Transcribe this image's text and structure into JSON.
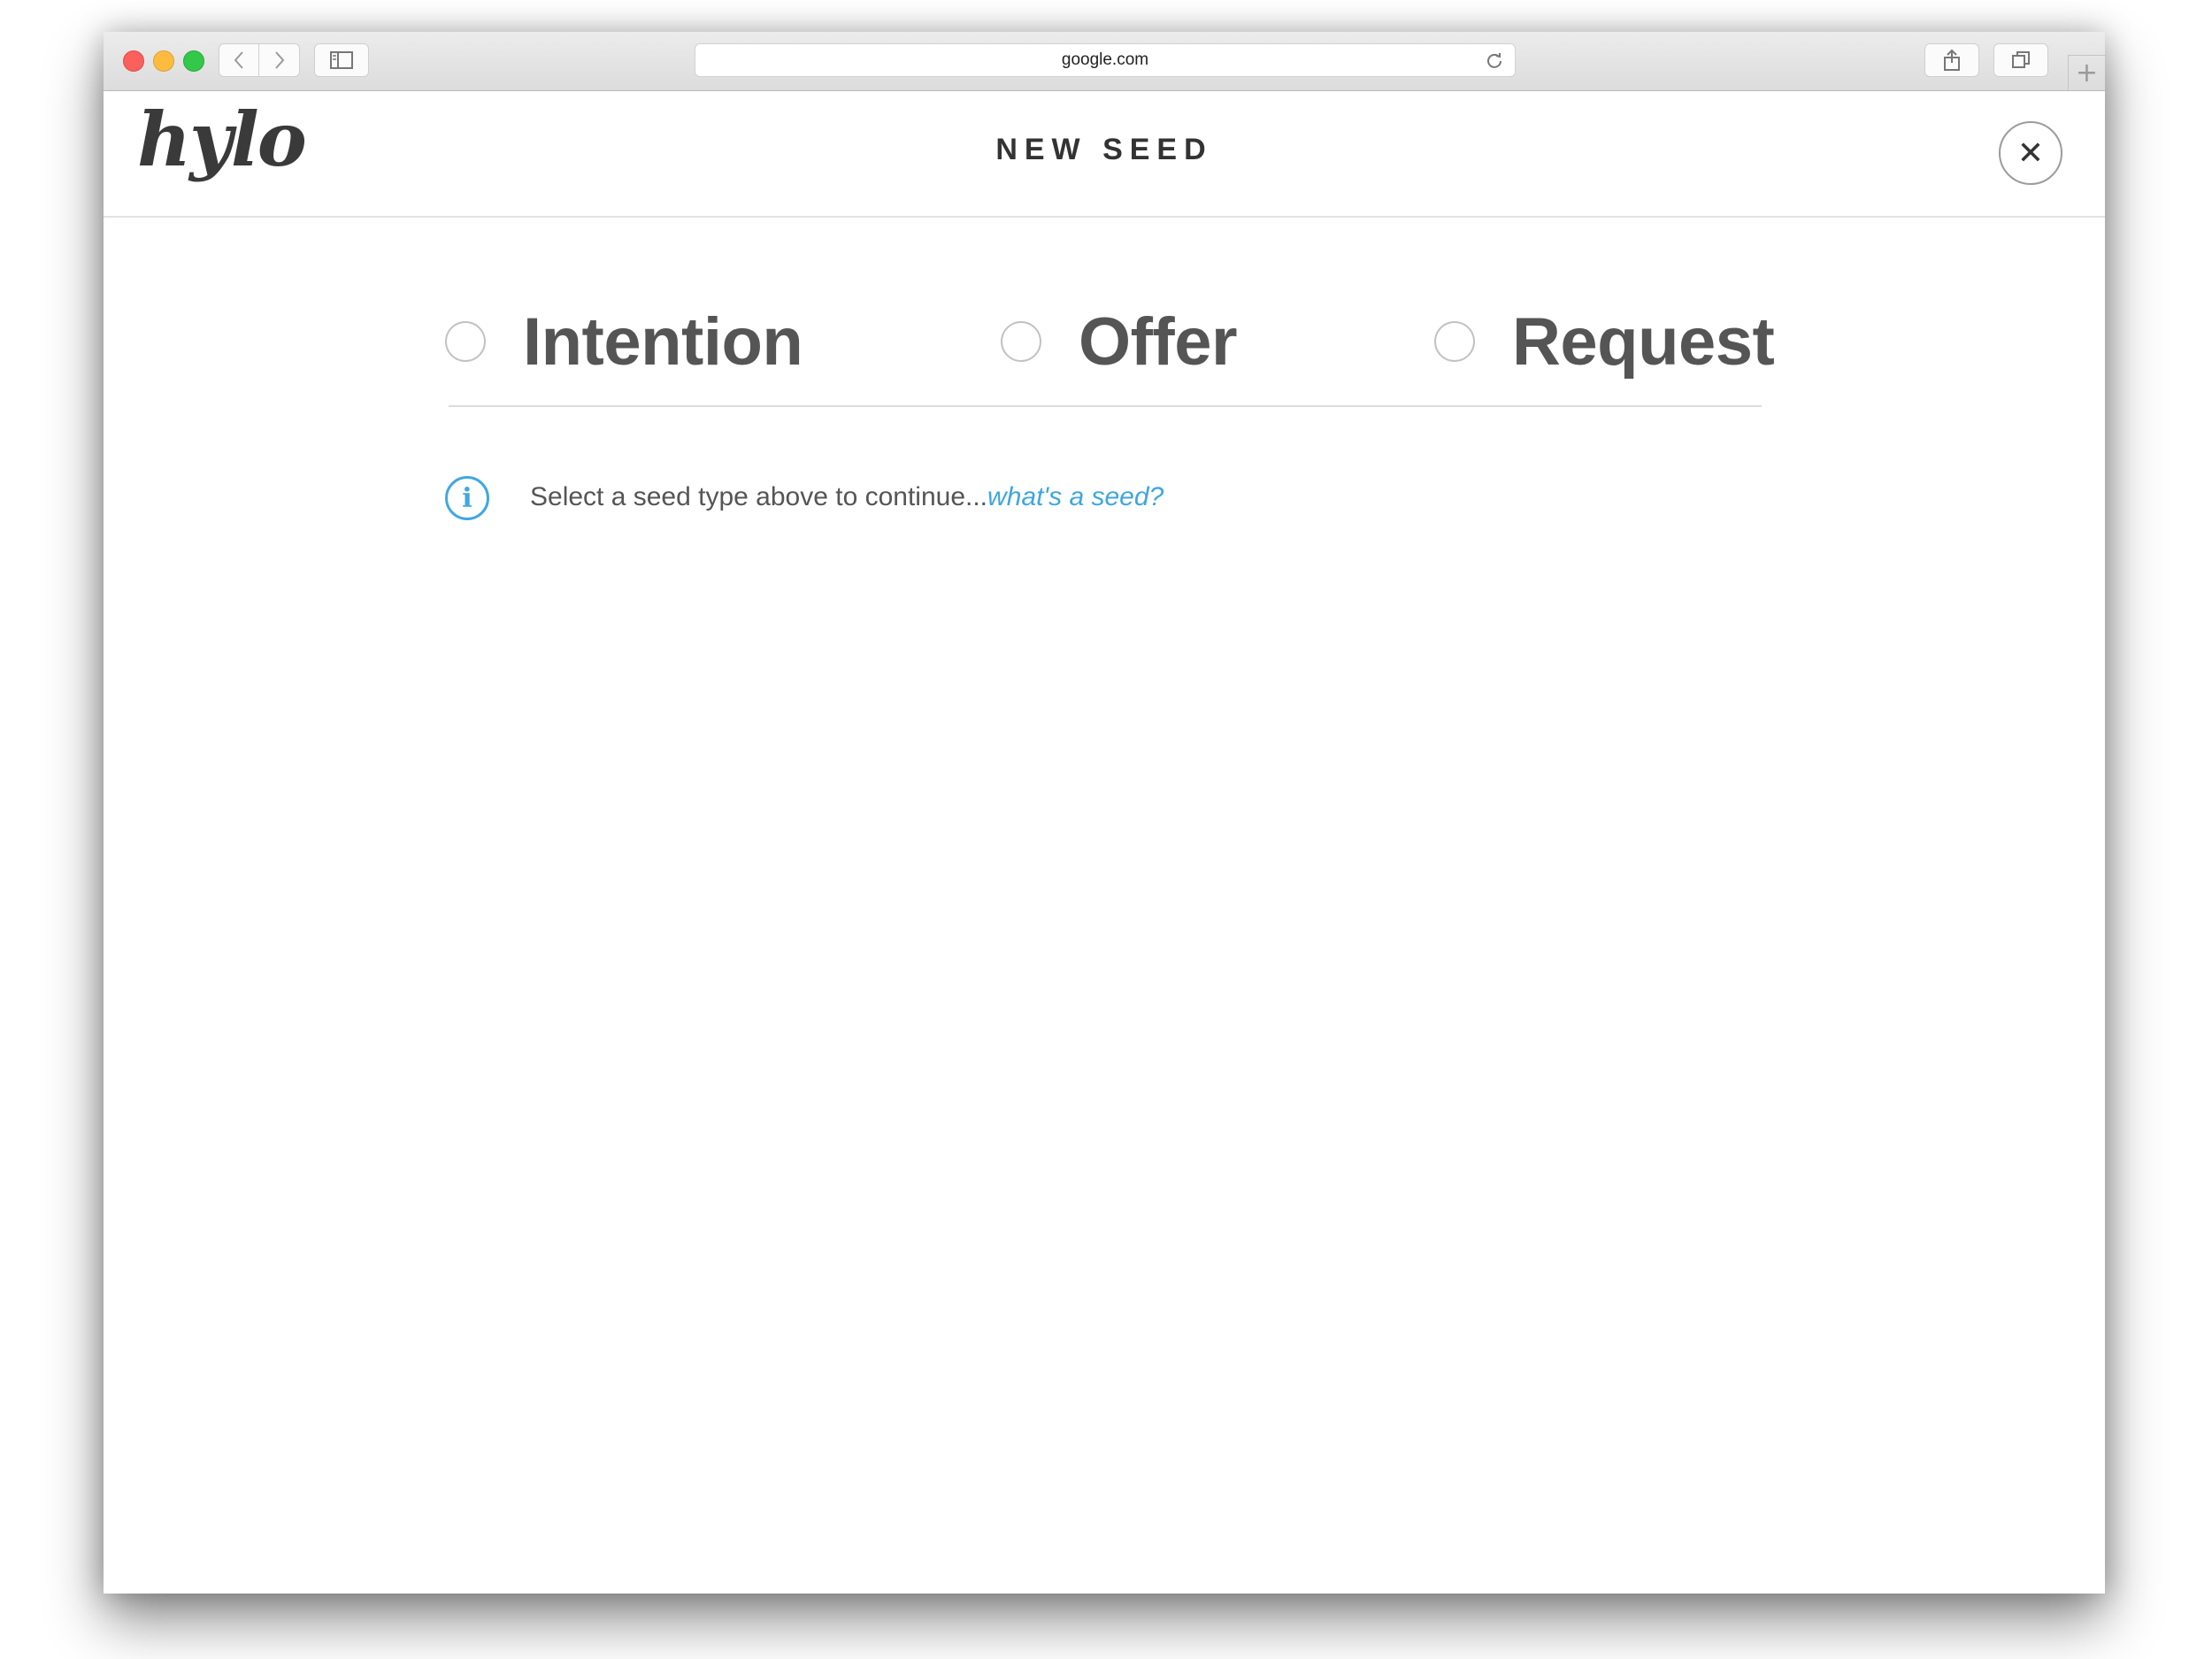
{
  "browser": {
    "url": "google.com",
    "back_icon": "chevron-left-icon",
    "forward_icon": "chevron-right-icon",
    "sidebar_icon": "sidebar-icon",
    "share_icon": "share-icon",
    "tabs_icon": "tabs-icon",
    "new_tab_icon": "plus-icon",
    "reload_icon": "reload-icon"
  },
  "header": {
    "logo": "hylo",
    "title": "NEW SEED",
    "close_icon": "close-icon"
  },
  "seed_types": {
    "options": [
      {
        "label": "Intention",
        "selected": false
      },
      {
        "label": "Offer",
        "selected": false
      },
      {
        "label": "Request",
        "selected": false
      }
    ]
  },
  "hint": {
    "text": "Select a seed type above to continue...",
    "link": "what's a seed?",
    "icon": "info-icon"
  },
  "colors": {
    "accent": "#3ea6e0",
    "text": "#555555",
    "title": "#333333"
  }
}
